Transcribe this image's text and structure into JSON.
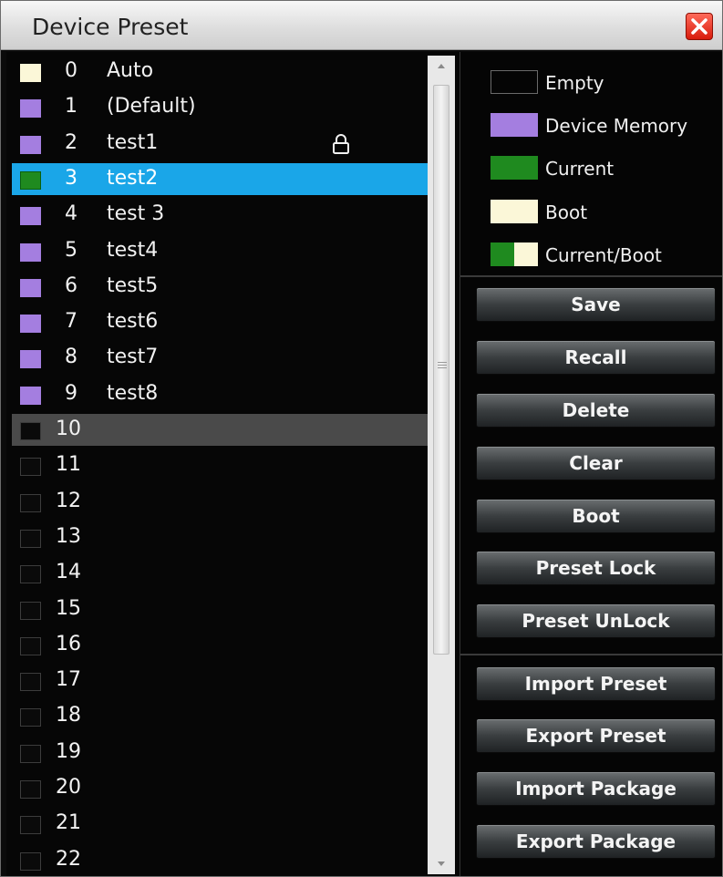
{
  "window": {
    "title": "Device Preset"
  },
  "colors": {
    "device_memory": "#a47ee0",
    "current": "#1f8a1f",
    "boot": "#fbf7d8",
    "selected_row": "#1aa6e8",
    "highlight_row": "#4a4a4a"
  },
  "presets": [
    {
      "num": "0",
      "name": "Auto",
      "state": "boot"
    },
    {
      "num": "1",
      "name": "(Default)",
      "state": "memory"
    },
    {
      "num": "2",
      "name": "test1",
      "state": "memory",
      "locked": true
    },
    {
      "num": "3",
      "name": "test2",
      "state": "current",
      "selected": true
    },
    {
      "num": "4",
      "name": "test 3",
      "state": "memory"
    },
    {
      "num": "5",
      "name": "test4",
      "state": "memory"
    },
    {
      "num": "6",
      "name": "test5",
      "state": "memory"
    },
    {
      "num": "7",
      "name": "test6",
      "state": "memory"
    },
    {
      "num": "8",
      "name": "test7",
      "state": "memory"
    },
    {
      "num": "9",
      "name": "test8",
      "state": "memory"
    },
    {
      "num": "10",
      "name": "",
      "state": "empty",
      "highlight": true
    },
    {
      "num": "11",
      "name": "",
      "state": "empty"
    },
    {
      "num": "12",
      "name": "",
      "state": "empty"
    },
    {
      "num": "13",
      "name": "",
      "state": "empty"
    },
    {
      "num": "14",
      "name": "",
      "state": "empty"
    },
    {
      "num": "15",
      "name": "",
      "state": "empty"
    },
    {
      "num": "16",
      "name": "",
      "state": "empty"
    },
    {
      "num": "17",
      "name": "",
      "state": "empty"
    },
    {
      "num": "18",
      "name": "",
      "state": "empty"
    },
    {
      "num": "19",
      "name": "",
      "state": "empty"
    },
    {
      "num": "20",
      "name": "",
      "state": "empty"
    },
    {
      "num": "21",
      "name": "",
      "state": "empty"
    },
    {
      "num": "22",
      "name": "",
      "state": "empty"
    }
  ],
  "legend": [
    {
      "label": "Empty",
      "key": "empty"
    },
    {
      "label": "Device Memory",
      "key": "memory"
    },
    {
      "label": "Current",
      "key": "current"
    },
    {
      "label": "Boot",
      "key": "boot"
    },
    {
      "label": "Current/Boot",
      "key": "current_boot"
    }
  ],
  "actions": {
    "save": "Save",
    "recall": "Recall",
    "delete": "Delete",
    "clear": "Clear",
    "boot": "Boot",
    "preset_lock": "Preset Lock",
    "preset_unlock": "Preset UnLock",
    "import_preset": "Import Preset",
    "export_preset": "Export Preset",
    "import_package": "Import Package",
    "export_package": "Export Package"
  }
}
